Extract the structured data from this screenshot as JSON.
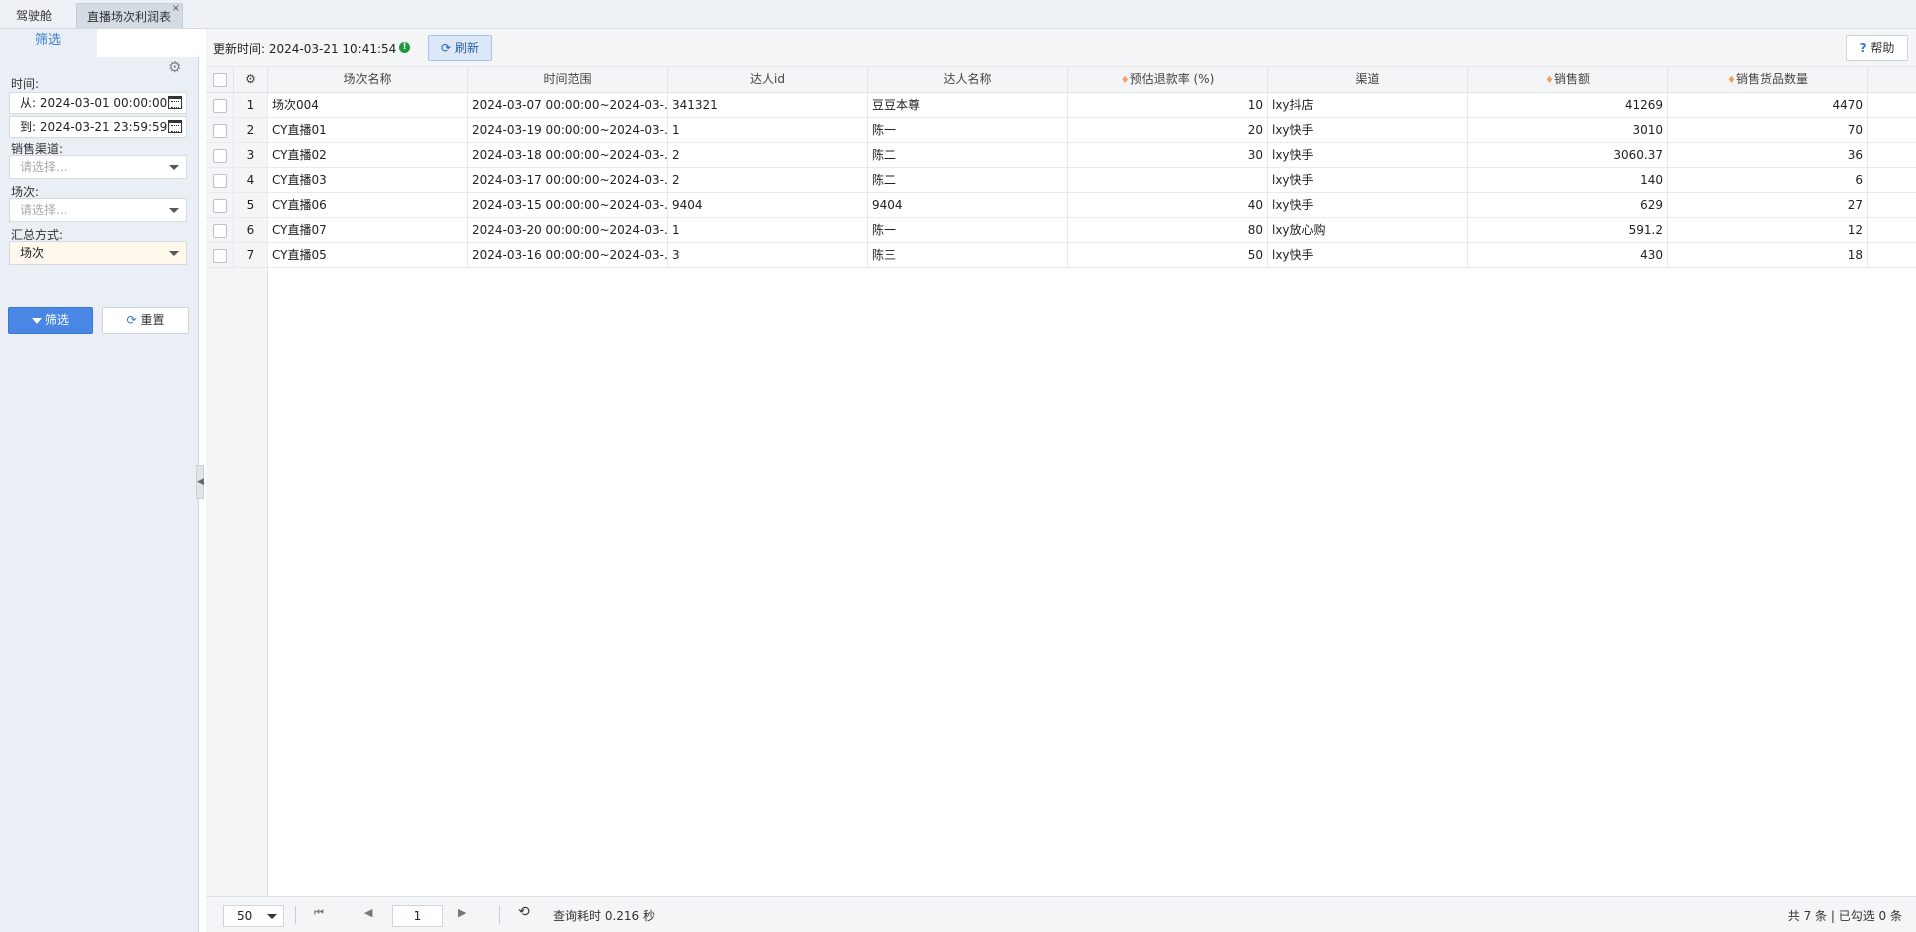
{
  "tabs": [
    {
      "label": "驾驶舱"
    },
    {
      "label": "直播场次利润表",
      "close": "×"
    }
  ],
  "sidebar": {
    "tab_label": "筛选",
    "time_label": "时间:",
    "from_value": "从: 2024-03-01 00:00:00",
    "to_value": "到: 2024-03-21 23:59:59",
    "channel_label": "销售渠道:",
    "channel_placeholder": "请选择...",
    "session_label": "场次:",
    "session_placeholder": "请选择...",
    "summary_label": "汇总方式:",
    "summary_value": "场次",
    "filter_button": "筛选",
    "reset_button": "重置"
  },
  "toolbar": {
    "update_text": "更新时间: 2024-03-21 10:41:54",
    "refresh_label": "刷新",
    "help_label": "帮助"
  },
  "table": {
    "columns": [
      "场次名称",
      "时间范围",
      "达人id",
      "达人名称",
      "预估退款率 (%)",
      "渠道",
      "销售额",
      "销售货品数量"
    ],
    "rows": [
      {
        "idx": "1",
        "name": "场次004",
        "range": "2024-03-07 00:00:00~2024-03-...",
        "anchor_id": "341321",
        "anchor_name": "豆豆本尊",
        "refund": "10",
        "channel": "lxy抖店",
        "sales": "41269",
        "qty": "4470"
      },
      {
        "idx": "2",
        "name": "CY直播01",
        "range": "2024-03-19 00:00:00~2024-03-...",
        "anchor_id": "1",
        "anchor_name": "陈一",
        "refund": "20",
        "channel": "lxy快手",
        "sales": "3010",
        "qty": "70"
      },
      {
        "idx": "3",
        "name": "CY直播02",
        "range": "2024-03-18 00:00:00~2024-03-...",
        "anchor_id": "2",
        "anchor_name": "陈二",
        "refund": "30",
        "channel": "lxy快手",
        "sales": "3060.37",
        "qty": "36"
      },
      {
        "idx": "4",
        "name": "CY直播03",
        "range": "2024-03-17 00:00:00~2024-03-...",
        "anchor_id": "2",
        "anchor_name": "陈二",
        "refund": "",
        "channel": "lxy快手",
        "sales": "140",
        "qty": "6"
      },
      {
        "idx": "5",
        "name": "CY直播06",
        "range": "2024-03-15 00:00:00~2024-03-...",
        "anchor_id": "9404",
        "anchor_name": "9404",
        "refund": "40",
        "channel": "lxy快手",
        "sales": "629",
        "qty": "27"
      },
      {
        "idx": "6",
        "name": "CY直播07",
        "range": "2024-03-20 00:00:00~2024-03-...",
        "anchor_id": "1",
        "anchor_name": "陈一",
        "refund": "80",
        "channel": "lxy放心购",
        "sales": "591.2",
        "qty": "12"
      },
      {
        "idx": "7",
        "name": "CY直播05",
        "range": "2024-03-16 00:00:00~2024-03-...",
        "anchor_id": "3",
        "anchor_name": "陈三",
        "refund": "50",
        "channel": "lxy快手",
        "sales": "430",
        "qty": "18"
      }
    ]
  },
  "pager": {
    "page_size": "50",
    "page": "1",
    "query_time": "查询耗时 0.216 秒",
    "total": "共 7 条 | 已勾选 0 条"
  }
}
